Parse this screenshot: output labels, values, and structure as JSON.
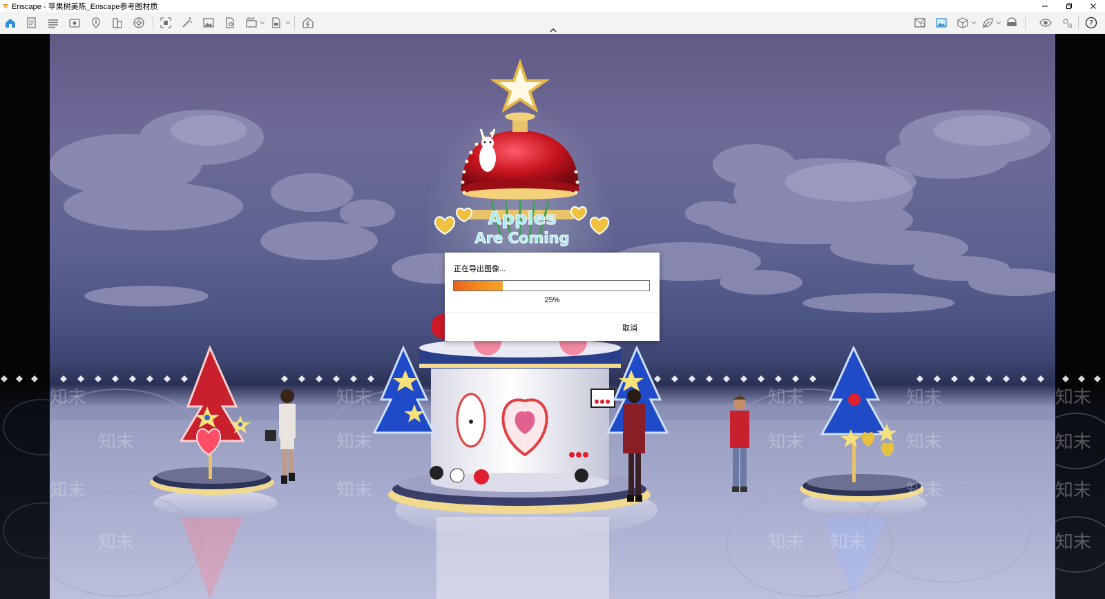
{
  "window": {
    "title": "Enscape - 苹果树美陈_Enscape参考图材质",
    "accent_color": "#e8601c"
  },
  "toolbar": {
    "left_icons": [
      "home-icon",
      "document-icon",
      "bim-icon",
      "view-icon",
      "capture-icon",
      "building-icon",
      "settings-wheel-icon",
      "screenshot-icon",
      "magic-wand-icon",
      "image-icon",
      "document-settings-icon",
      "video-icon",
      "export-icon",
      "upload-icon"
    ],
    "right_icons": [
      "map-icon",
      "image-gallery-icon",
      "cube-icon",
      "leaf-icon",
      "vr-headset-icon",
      "eye-icon",
      "gear-icon",
      "help-icon"
    ],
    "help_label": "?"
  },
  "scene": {
    "sign_line1": "Apples",
    "sign_line2": "Are Coming",
    "watermark": "知末"
  },
  "dialog": {
    "title": "正在导出图像...",
    "progress": 0.25,
    "progress_label": "25%",
    "cancel_label": "取消"
  }
}
